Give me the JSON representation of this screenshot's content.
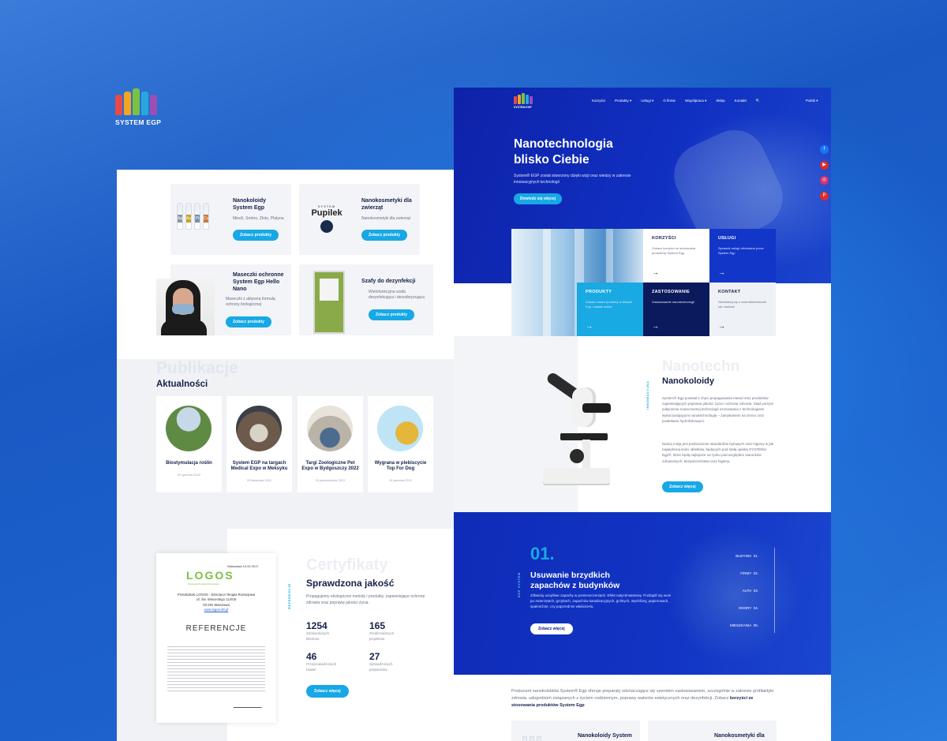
{
  "brand": {
    "name": "SYSTEM EGP",
    "colors": [
      "#e83e3e",
      "#f4a623",
      "#7cc242",
      "#2aa9e0",
      "#8e44ad"
    ]
  },
  "left": {
    "products": [
      {
        "title": "Nanokoloidy System Egp",
        "desc": "Miedź, Srebro, Złoto, Platyna",
        "button": "Zobacz produkty",
        "labels": [
          "Ag",
          "Au",
          "Pt",
          "Cu"
        ]
      },
      {
        "title": "Nanokosmetyki dla zwierząt",
        "desc": "Nanokosmetyki dla zwierząt",
        "button": "Zobacz produkty",
        "logo_top": "SYSTEM",
        "logo": "Pupilek"
      },
      {
        "title": "Maseczki ochronne System Egp Hello Nano",
        "desc": "Maseczki z aktywną formułą ochrony biologicznej",
        "button": "Zobacz produkty"
      },
      {
        "title": "Szafy do dezynfekcji",
        "desc": "Wielofunkcyjna szafa dezynfekująca i dezodoryzująca",
        "button": "Zobacz produkty"
      }
    ],
    "publications": {
      "ghost": "Publikacje",
      "title": "Aktualności",
      "items": [
        {
          "title": "Biostymulacja roślin",
          "date": "30 grudnia 2022"
        },
        {
          "title": "System EGP na targach Medical Expo w Meksyku",
          "date": "23 listopada 2022"
        },
        {
          "title": "Targi Zoologiczne Pet Expo w Bydgoszczy 2022",
          "date": "19 października 2022"
        },
        {
          "title": "Wygrana w plebiscycie Top For Dog",
          "date": "19 grudnia 2021"
        }
      ]
    },
    "cert": {
      "ghost": "Certyfikaty",
      "title": "Sprawdzona jakość",
      "vertical": "REFERENCJE",
      "desc": "Propagujemy ekologiczne metody i produkty, zapewniające ochronę zdrowia oraz poprawę jakości życia.",
      "stats": [
        {
          "value": "1254",
          "label": "Zadowolonych klientów"
        },
        {
          "value": "165",
          "label": "Zrealizowanych projektów"
        },
        {
          "value": "46",
          "label": "Przeprowadzonych badań"
        },
        {
          "value": "27",
          "label": "Sprawdzonych preparatów"
        }
      ],
      "button": "Zobacz więcej",
      "doc": {
        "date": "Warszawa 10.02.2017",
        "logo": "LOGOS",
        "logo_sub": "Dziecięca Terapia Rozwojowa",
        "heading": "REFERENCJE",
        "lines": [
          "Przedszkole LOGOS - Dziecięca Terapia Rozwojowa",
          "Ul. Św. Wincentego 114/U5",
          "03-291 Warszawa",
          "www.logos-dtr.pl"
        ]
      }
    }
  },
  "right": {
    "nav": [
      "Korzyści",
      "Produkty ▾",
      "Usługi ▾",
      "O firmie",
      "Współpraca ▾",
      "Sklep",
      "Kontakt",
      "🔍"
    ],
    "lang": "Polski ▾",
    "hero": {
      "title_line1": "Nanotechnologia",
      "title_line2": "blisko Ciebie",
      "text": "System® EGP został stworzony dzięki wizji oraz wiedzy w zakresie innowacyjnych technologii",
      "button": "Dowiedz się więcej"
    },
    "social": [
      {
        "icon": "facebook-icon",
        "glyph": "f",
        "color": "#1877f2"
      },
      {
        "icon": "youtube-icon",
        "glyph": "▶",
        "color": "#e02b2b"
      },
      {
        "icon": "instagram-icon",
        "glyph": "◎",
        "color": "#d6336c"
      },
      {
        "icon": "pinterest-icon",
        "glyph": "P",
        "color": "#e02b2b"
      }
    ],
    "tiles": [
      {
        "title": "KORZYŚCI",
        "text": "Zobacz korzyści ze stosowania produktów System Egp"
      },
      {
        "title": "USŁUGI",
        "text": "Sprawdź usługi oferowane przez System Egp"
      },
      {
        "title": "PRODUKTY",
        "text": "Zobacz nasze produkty w sklepie. Kup i zapłać online"
      },
      {
        "title": "ZASTOSOWANIE",
        "text": "Zastosowanie nanotechnologii"
      },
      {
        "title": "KONTAKT",
        "text": "Skontaktuj się z nami telefonicznie lub mailowo"
      }
    ],
    "nano": {
      "ghost": "Nanotechn",
      "title": "Nanokoloidy",
      "vertical": "INNOWACYJNA",
      "p1": "System® Egp powstał z chęci propagowania metod oraz produktów zapewniających poprawę jakości życia i ochronę zdrowia. Stąd pomysł połączenia nowoczesnej technologii ozonowania z technologiami wykorzystującymi nanotechnologię – zamykaniem na zimno oraz powłokami hydrofobowymi.",
      "p2": "Naszą misją jest podnoszenie standardów bytowych oraz higieny w jak największej ilości obiektów, będących pod stałą opieką SYSTEMU Egp®, które będą najlepsze na rynku pod względem warunków zdrowotnych, bezpieczeństwa oraz higieny.",
      "button": "Zobacz więcej"
    },
    "feature": {
      "number": "01.",
      "vertical": "EGP SYSTEM",
      "title_line1": "Usuwanie brzydkich",
      "title_line2": "zapachów z budynków",
      "text": "Zlikwiduj uciążliwe zapachy w pomieszczeniach. Efekt natychmiastowy. Pozbądź się woni po zwierzętach, grzybach, zapachów kanalizacyjnych, gnilnych, stęchlizny, papierosach, spaleniźnie, czy poprzednim właścicielu.",
      "button": "Zobacz więcej",
      "list": [
        {
          "label": "BUDYNKI",
          "num": "01."
        },
        {
          "label": "FIRMY",
          "num": "02."
        },
        {
          "label": "AUTA",
          "num": "03."
        },
        {
          "label": "ODORY",
          "num": "04."
        },
        {
          "label": "MIESZKANIA",
          "num": "05."
        }
      ]
    },
    "bottom": {
      "text": "Producent nanokoloidów System® Egp oferuje preparaty odznaczające się szerokim zastosowaniem, szczególnie w zakresie profilaktyki zdrowia, udogodnień związanych z życiem codziennym, poprawy walorów estetycznych oraz dezynfekcji. Zobacz",
      "link": "korzyści ze stosowania produktów System Egp",
      "cards": [
        "Nanokoloidy System",
        "Nanokosmetyki dla"
      ]
    }
  }
}
